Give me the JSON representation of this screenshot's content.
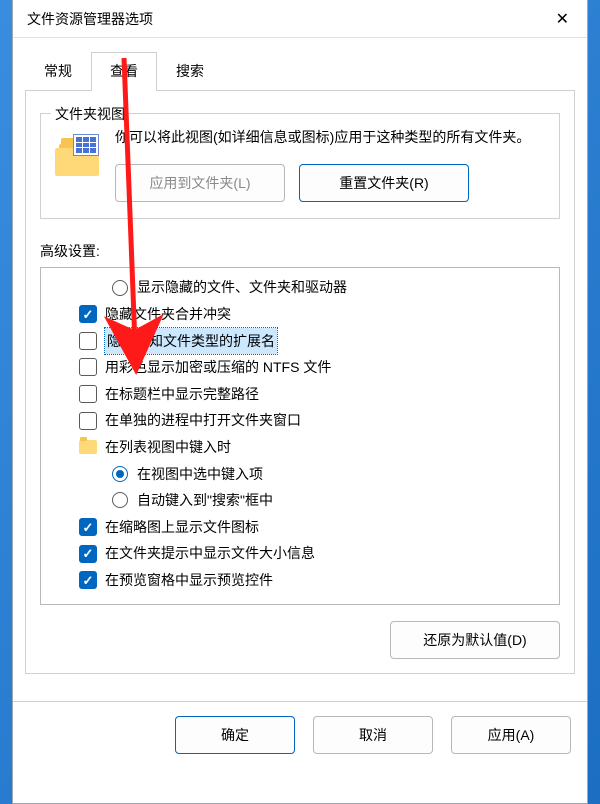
{
  "window": {
    "title": "文件资源管理器选项"
  },
  "tabs": {
    "general": "常规",
    "view": "查看",
    "search": "搜索"
  },
  "folder_views": {
    "legend": "文件夹视图",
    "description": "你可以将此视图(如详细信息或图标)应用于这种类型的所有文件夹。",
    "apply_btn": "应用到文件夹(L)",
    "reset_btn": "重置文件夹(R)"
  },
  "advanced": {
    "label": "高级设置:",
    "items": [
      {
        "kind": "radio",
        "depth": 1,
        "checked": false,
        "text": "显示隐藏的文件、文件夹和驱动器"
      },
      {
        "kind": "check",
        "depth": 0,
        "checked": true,
        "text": "隐藏文件夹合并冲突"
      },
      {
        "kind": "check",
        "depth": 0,
        "checked": false,
        "text": "隐藏已知文件类型的扩展名",
        "selected": true
      },
      {
        "kind": "check",
        "depth": 0,
        "checked": false,
        "text": "用彩色显示加密或压缩的 NTFS 文件"
      },
      {
        "kind": "check",
        "depth": 0,
        "checked": false,
        "text": "在标题栏中显示完整路径"
      },
      {
        "kind": "check",
        "depth": 0,
        "checked": false,
        "text": "在单独的进程中打开文件夹窗口"
      },
      {
        "kind": "folder",
        "depth": 0,
        "text": "在列表视图中键入时"
      },
      {
        "kind": "radio",
        "depth": 1,
        "checked": true,
        "text": "在视图中选中键入项"
      },
      {
        "kind": "radio",
        "depth": 1,
        "checked": false,
        "text": "自动键入到\"搜索\"框中"
      },
      {
        "kind": "check",
        "depth": 0,
        "checked": true,
        "text": "在缩略图上显示文件图标"
      },
      {
        "kind": "check",
        "depth": 0,
        "checked": true,
        "text": "在文件夹提示中显示文件大小信息"
      },
      {
        "kind": "check",
        "depth": 0,
        "checked": true,
        "text": "在预览窗格中显示预览控件"
      }
    ],
    "restore_btn": "还原为默认值(D)"
  },
  "footer": {
    "ok": "确定",
    "cancel": "取消",
    "apply": "应用(A)"
  }
}
